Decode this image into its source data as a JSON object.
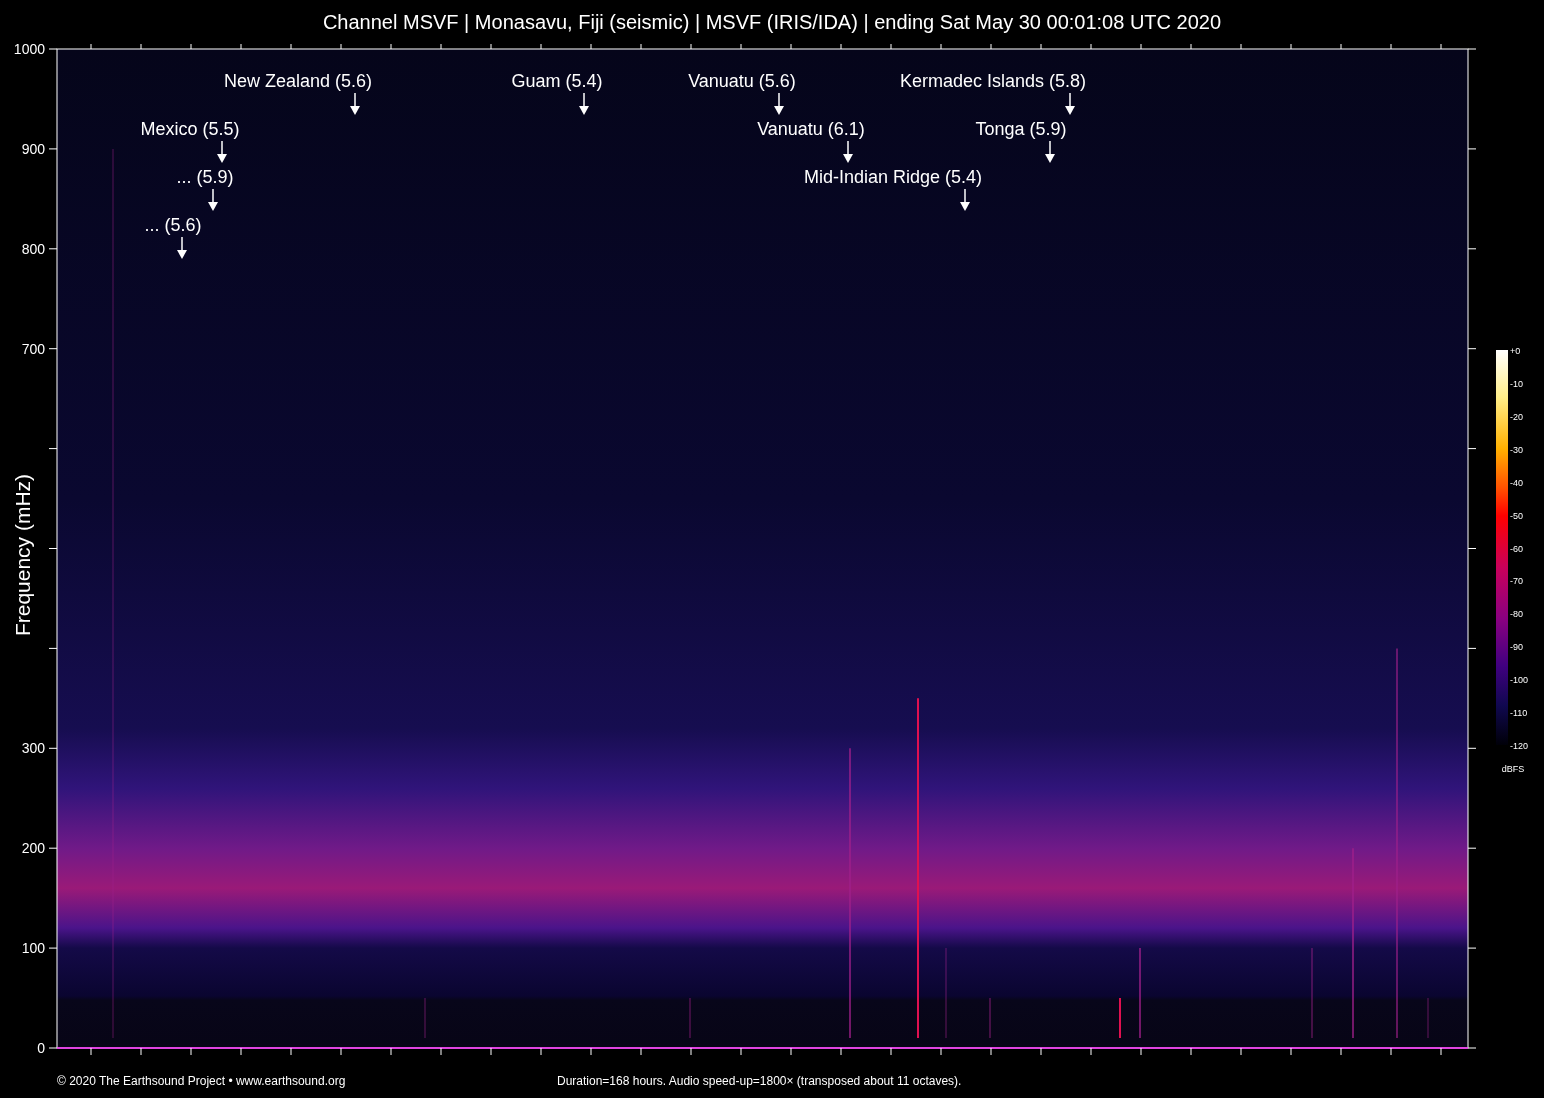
{
  "title": "Channel MSVF | Monasavu, Fiji (seismic) | MSVF (IRIS/IDA) | ending Sat May 30 00:01:08 UTC 2020",
  "y_axis": {
    "label": "Frequency (mHz)",
    "ticks": [
      "1000",
      "900",
      "800",
      "700",
      "300",
      "200",
      "100",
      "0"
    ]
  },
  "events": [
    {
      "label": "New Zealand (5.6)"
    },
    {
      "label": "Guam (5.4)"
    },
    {
      "label": "Vanuatu (5.6)"
    },
    {
      "label": "Kermadec Islands (5.8)"
    },
    {
      "label": "Mexico (5.5)"
    },
    {
      "label": "Vanuatu (6.1)"
    },
    {
      "label": "Tonga (5.9)"
    },
    {
      "label": "... (5.9)"
    },
    {
      "label": "Mid-Indian Ridge (5.4)"
    },
    {
      "label": "... (5.6)"
    }
  ],
  "colorbar": {
    "ticks": [
      "+0",
      "-10",
      "-20",
      "-30",
      "-40",
      "-50",
      "-60",
      "-70",
      "-80",
      "-90",
      "-100",
      "-110",
      "-120"
    ],
    "unit": "dBFS"
  },
  "footer": {
    "copyright": "© 2020 The Earthsound Project • www.earthsound.org",
    "note": "Duration=168 hours. Audio speed-up=1800× (transposed about 11 octaves)."
  }
}
